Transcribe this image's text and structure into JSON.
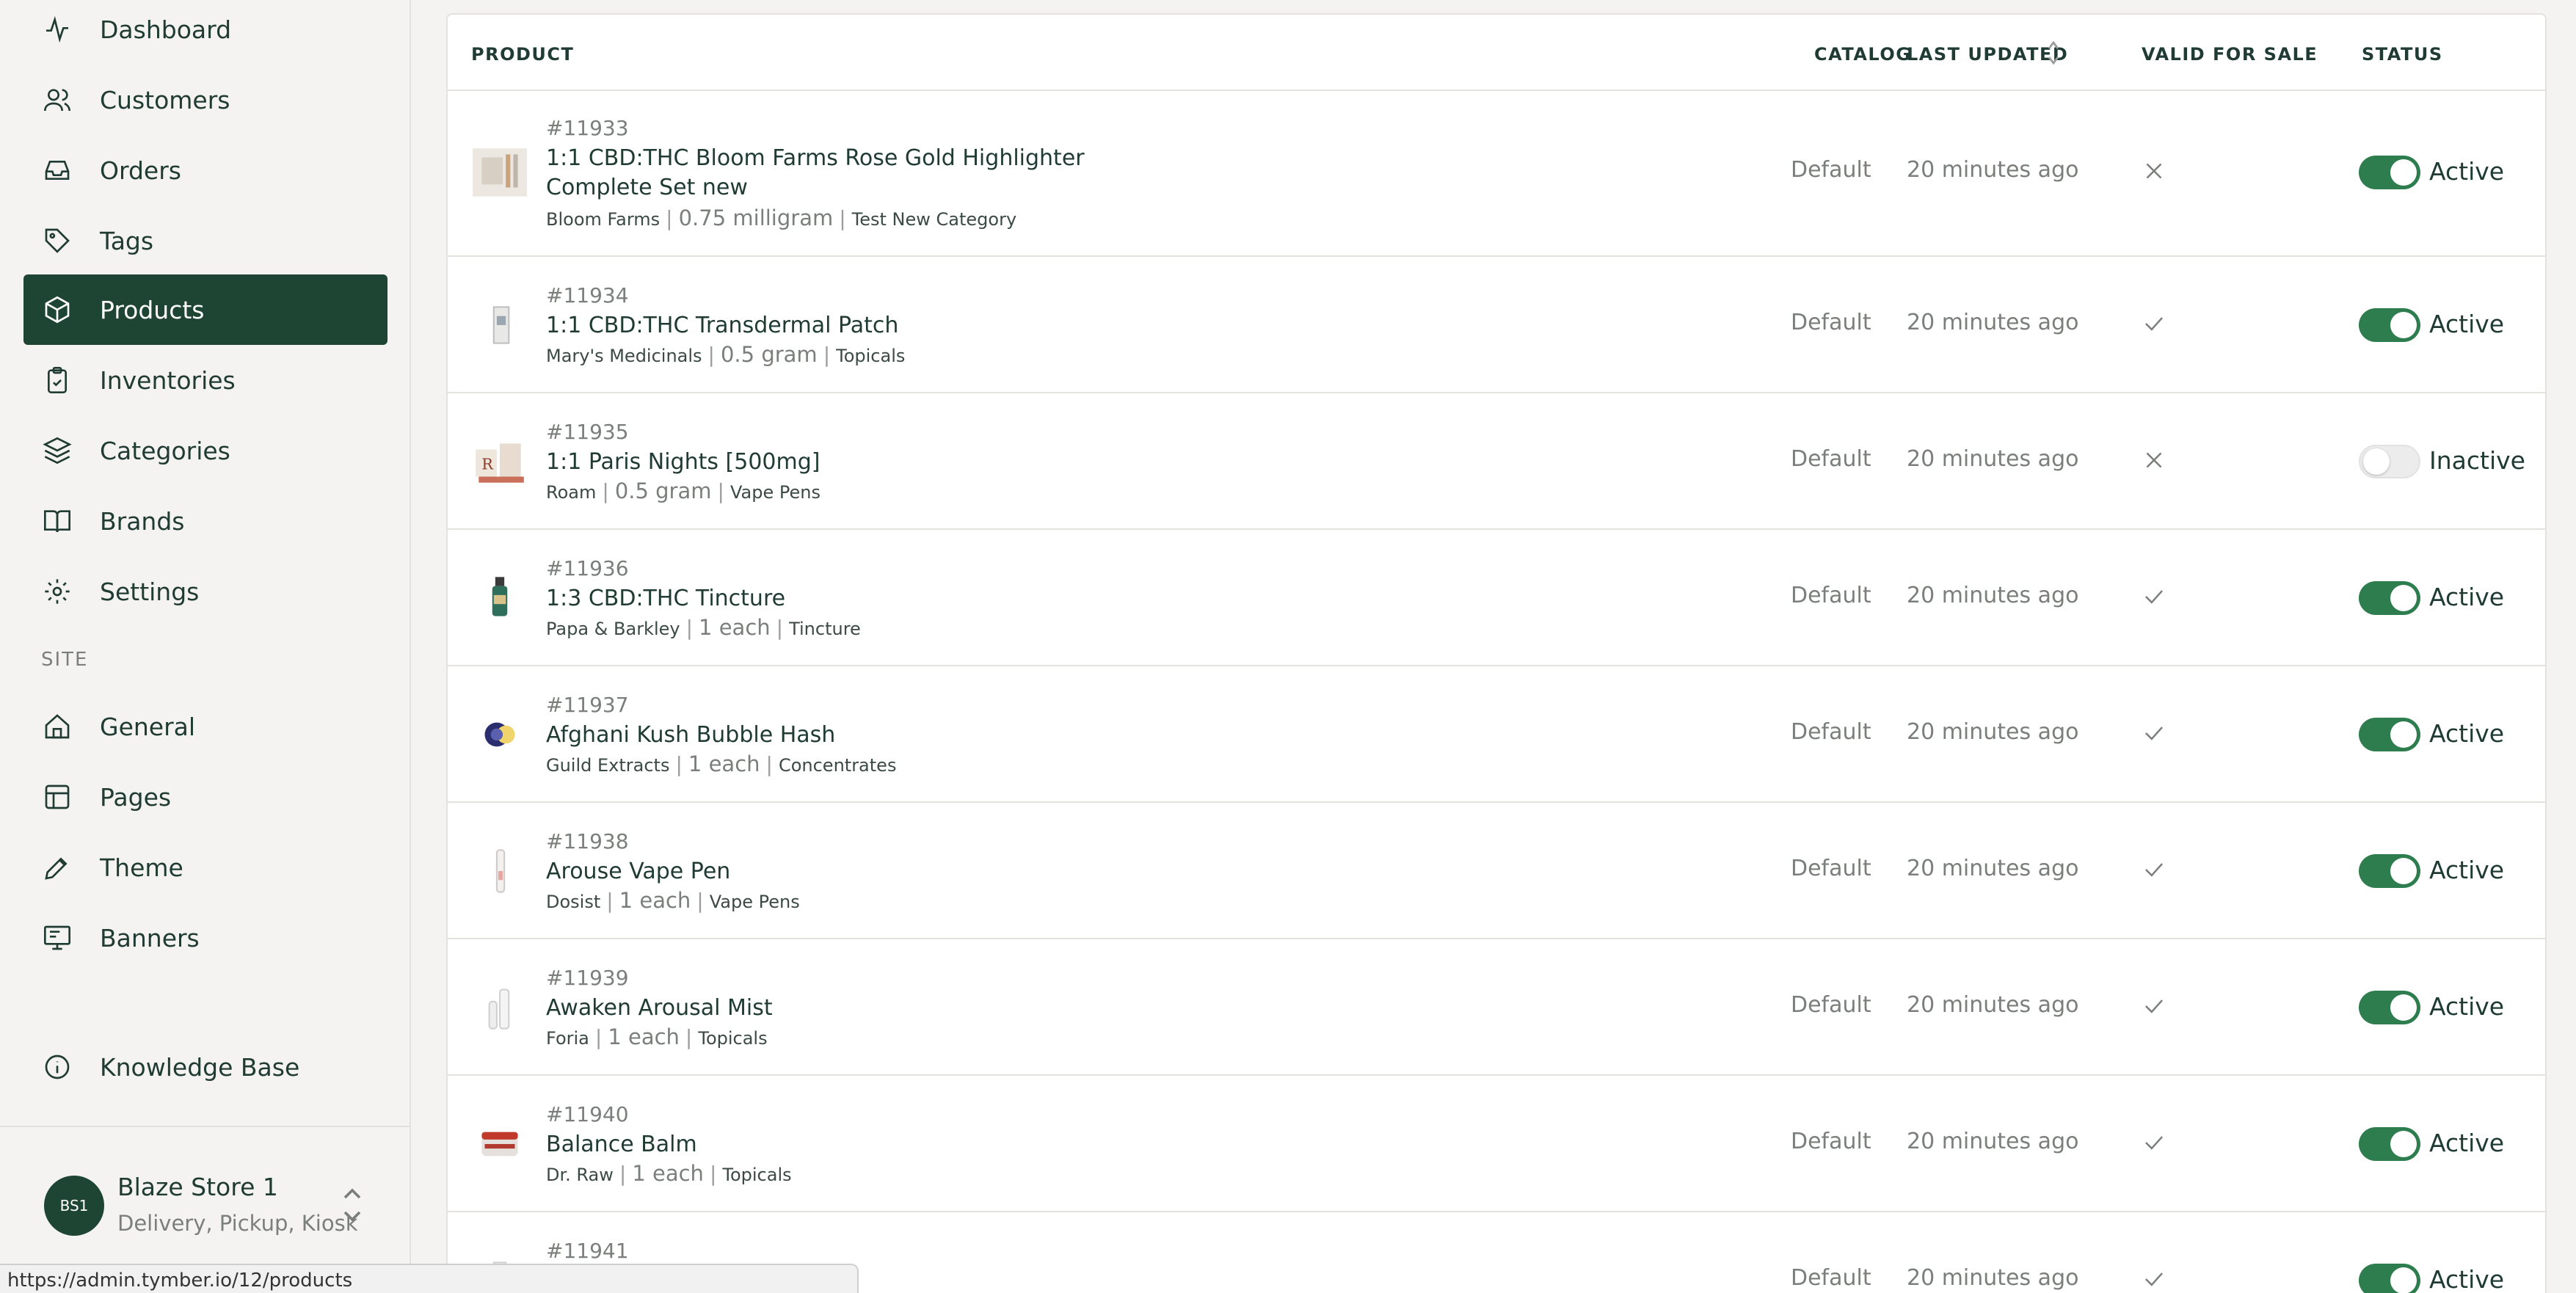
{
  "sidebar": {
    "items": [
      {
        "label": "Dashboard",
        "icon": "activity-icon"
      },
      {
        "label": "Customers",
        "icon": "users-icon"
      },
      {
        "label": "Orders",
        "icon": "inbox-icon"
      },
      {
        "label": "Tags",
        "icon": "tag-icon"
      },
      {
        "label": "Products",
        "icon": "box-icon",
        "active": true
      },
      {
        "label": "Inventories",
        "icon": "clipboard-icon"
      },
      {
        "label": "Categories",
        "icon": "layers-icon"
      },
      {
        "label": "Brands",
        "icon": "book-icon"
      },
      {
        "label": "Settings",
        "icon": "gear-icon"
      }
    ],
    "site_label": "SITE",
    "site_items": [
      {
        "label": "General",
        "icon": "home-icon"
      },
      {
        "label": "Pages",
        "icon": "layout-icon"
      },
      {
        "label": "Theme",
        "icon": "brush-icon"
      },
      {
        "label": "Banners",
        "icon": "monitor-icon"
      }
    ],
    "knowledge_base": {
      "label": "Knowledge Base",
      "icon": "info-icon"
    },
    "store": {
      "initials": "BS1",
      "name": "Blaze Store 1",
      "subtitle": "Delivery, Pickup, Kiosk"
    }
  },
  "status_url": "https://admin.tymber.io/12/products",
  "table": {
    "headers": {
      "product": "PRODUCT",
      "catalog": "CATALOG",
      "last_updated": "LAST UPDATED",
      "valid_for_sale": "VALID FOR SALE",
      "status": "STATUS"
    },
    "rows": [
      {
        "id": "#11933",
        "name": "1:1 CBD:THC Bloom Farms Rose Gold Highlighter Complete Set new",
        "brand": "Bloom Farms",
        "amount": "0.75 milligram",
        "category": "Test New Category",
        "catalog": "Default",
        "updated": "20 minutes ago",
        "valid": false,
        "active": true,
        "status": "Active"
      },
      {
        "id": "#11934",
        "name": "1:1 CBD:THC Transdermal Patch",
        "brand": "Mary's Medicinals",
        "amount": "0.5 gram",
        "category": "Topicals",
        "catalog": "Default",
        "updated": "20 minutes ago",
        "valid": true,
        "active": true,
        "status": "Active"
      },
      {
        "id": "#11935",
        "name": "1:1 Paris Nights [500mg]",
        "brand": "Roam",
        "amount": "0.5 gram",
        "category": "Vape Pens",
        "catalog": "Default",
        "updated": "20 minutes ago",
        "valid": false,
        "active": false,
        "status": "Inactive"
      },
      {
        "id": "#11936",
        "name": "1:3 CBD:THC Tincture",
        "brand": "Papa & Barkley",
        "amount": "1 each",
        "category": "Tincture",
        "catalog": "Default",
        "updated": "20 minutes ago",
        "valid": true,
        "active": true,
        "status": "Active"
      },
      {
        "id": "#11937",
        "name": "Afghani Kush Bubble Hash",
        "brand": "Guild Extracts",
        "amount": "1 each",
        "category": "Concentrates",
        "catalog": "Default",
        "updated": "20 minutes ago",
        "valid": true,
        "active": true,
        "status": "Active"
      },
      {
        "id": "#11938",
        "name": "Arouse Vape Pen",
        "brand": "Dosist",
        "amount": "1 each",
        "category": "Vape Pens",
        "catalog": "Default",
        "updated": "20 minutes ago",
        "valid": true,
        "active": true,
        "status": "Active"
      },
      {
        "id": "#11939",
        "name": "Awaken Arousal Mist",
        "brand": "Foria",
        "amount": "1 each",
        "category": "Topicals",
        "catalog": "Default",
        "updated": "20 minutes ago",
        "valid": true,
        "active": true,
        "status": "Active"
      },
      {
        "id": "#11940",
        "name": "Balance Balm",
        "brand": "Dr. Raw",
        "amount": "1 each",
        "category": "Topicals",
        "catalog": "Default",
        "updated": "20 minutes ago",
        "valid": true,
        "active": true,
        "status": "Active"
      },
      {
        "id": "#11941",
        "name": "",
        "brand": "",
        "amount": "",
        "category": "",
        "catalog": "Default",
        "updated": "20 minutes ago",
        "valid": true,
        "active": true,
        "status": "Active"
      }
    ]
  },
  "colors": {
    "accent": "#1e4434",
    "toggle_on": "#2e7d4f",
    "muted": "#7b7f7c"
  }
}
